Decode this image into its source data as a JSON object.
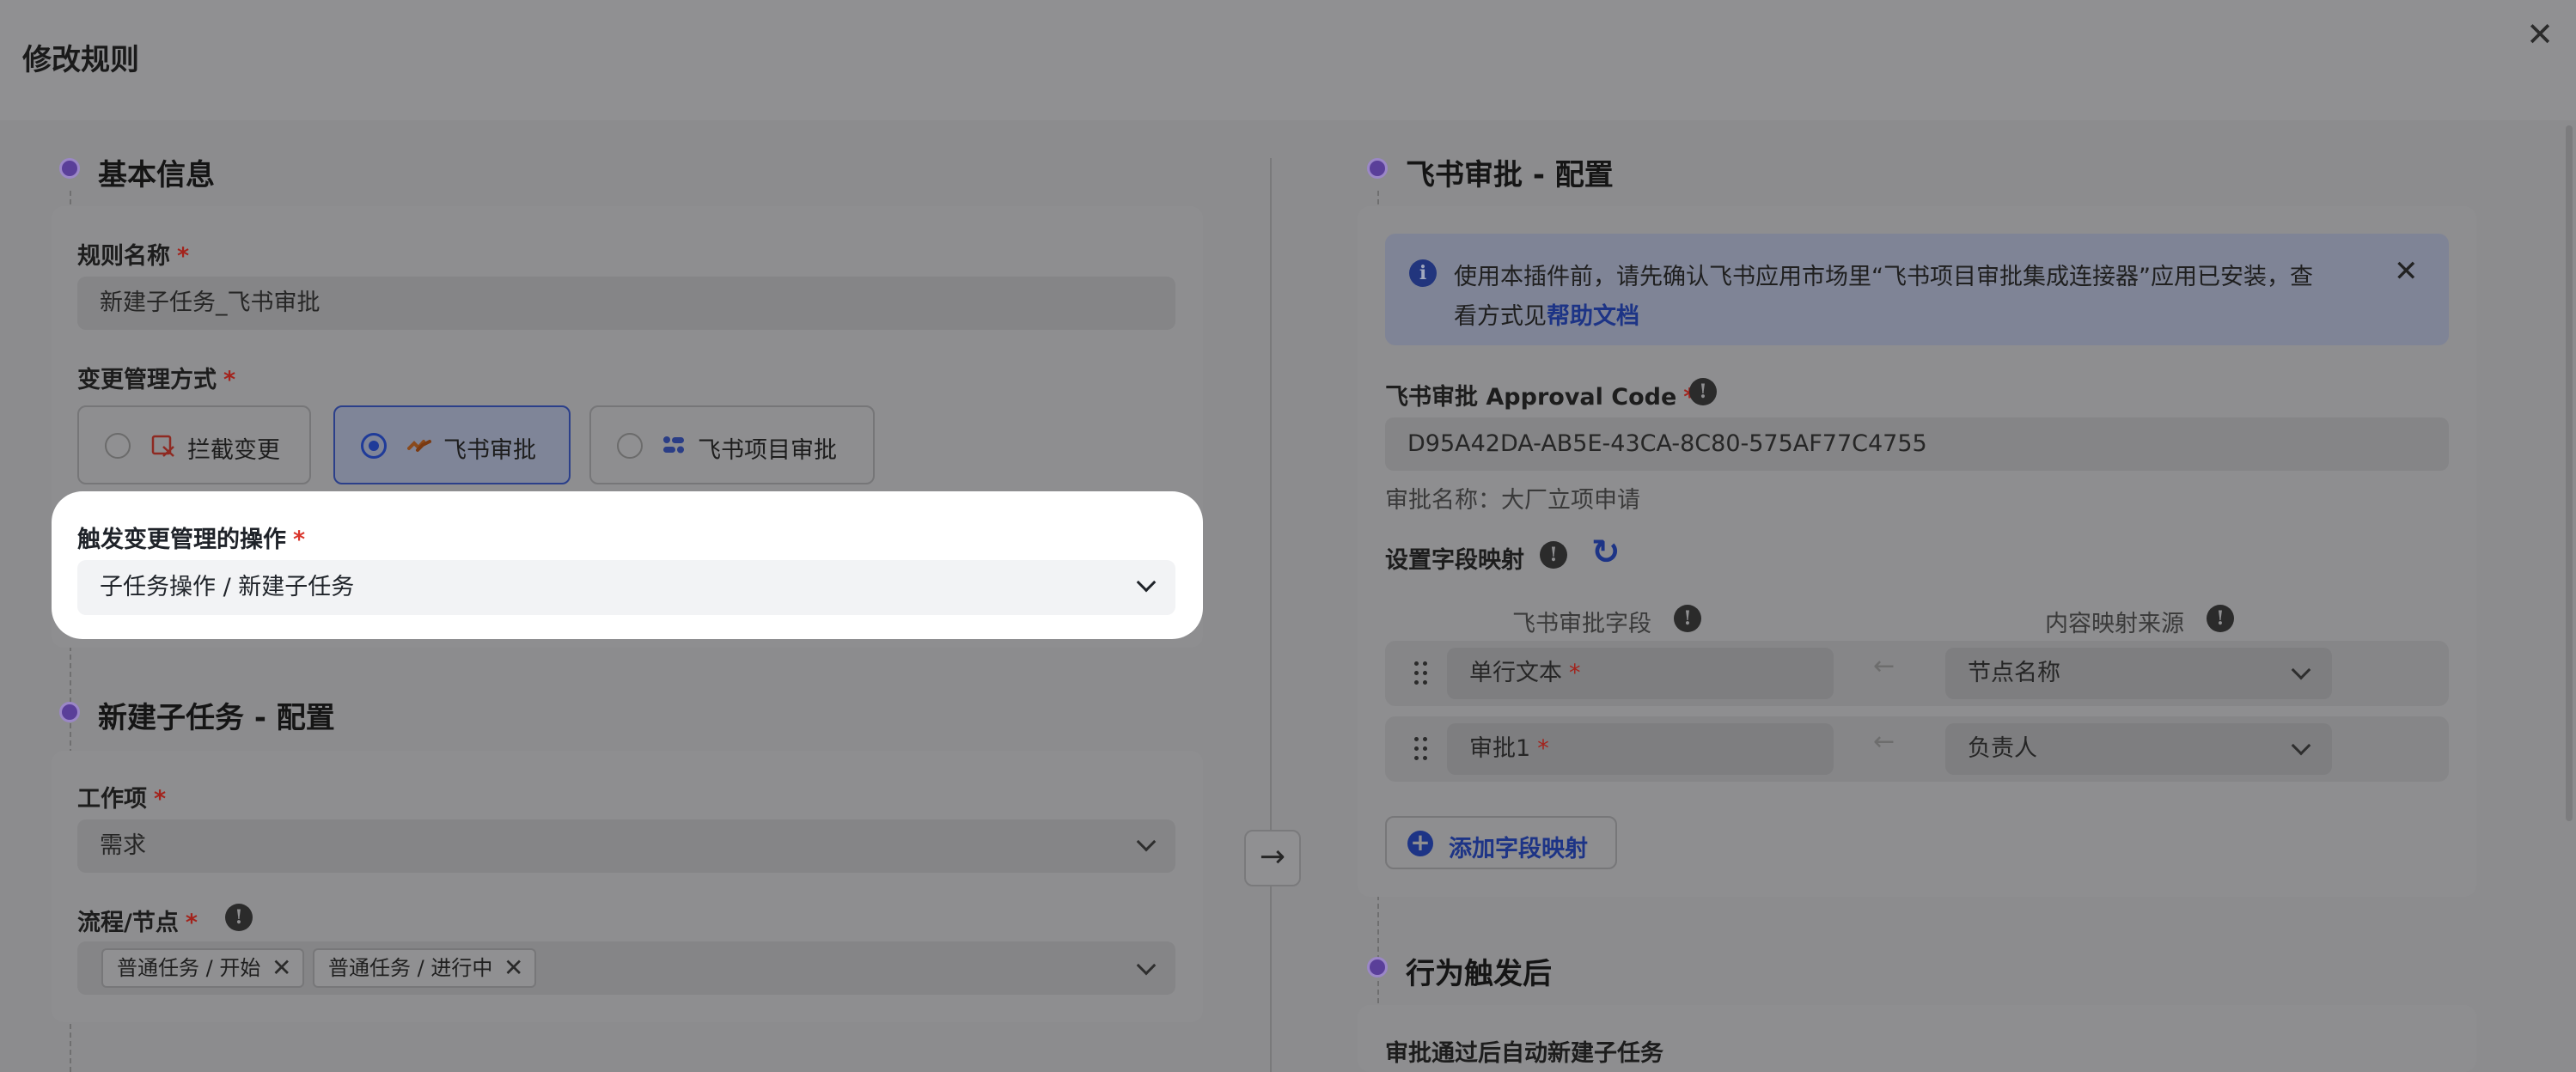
{
  "header": {
    "title": "修改规则",
    "close": "✕"
  },
  "left": {
    "basic": {
      "title": "基本信息",
      "rule_name_label": "规则名称",
      "rule_name_value": "新建子任务_飞书审批",
      "change_mode_label": "变更管理方式",
      "options": [
        {
          "label": "拦截变更",
          "selected": false
        },
        {
          "label": "飞书审批",
          "selected": true
        },
        {
          "label": "飞书项目审批",
          "selected": false
        }
      ],
      "trigger_label": "触发变更管理的操作",
      "trigger_value": "子任务操作 / 新建子任务"
    },
    "subtask": {
      "title": "新建子任务 - 配置",
      "work_item_label": "工作项",
      "work_item_value": "需求",
      "flow_label": "流程/节点",
      "tags": [
        "普通任务 / 开始",
        "普通任务 / 进行中"
      ]
    }
  },
  "right": {
    "feishu": {
      "title": "飞书审批 - 配置",
      "banner_text_1": "使用本插件前，请先确认飞书应用市场里“飞书项目审批集成连接器”应用已安装，查",
      "banner_text_2": "看方式见",
      "banner_link": "帮助文档",
      "approval_code_label": "飞书审批 Approval Code",
      "approval_code_value": "D95A42DA-AB5E-43CA-8C80-575AF77C4755",
      "approval_name": "审批名称：大厂立项申请",
      "mapping_label": "设置字段映射",
      "col_field": "飞书审批字段",
      "col_source": "内容映射来源",
      "rows": [
        {
          "field": "单行文本",
          "source": "节点名称"
        },
        {
          "field": "审批1",
          "source": "负责人"
        }
      ],
      "add_mapping": "添加字段映射"
    },
    "after": {
      "title": "行为触发后",
      "auto_create_label": "审批通过后自动新建子任务"
    }
  },
  "icons": {
    "info": "i",
    "warn": "!",
    "refresh": "↻",
    "arrow_right": "→",
    "arrow_left": "←",
    "tag_close": "✕"
  }
}
